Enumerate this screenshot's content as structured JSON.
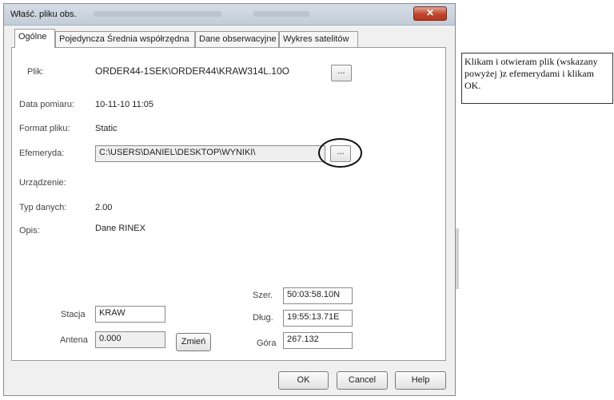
{
  "window": {
    "title": "Właść. pliku obs."
  },
  "tabs": [
    "Ogólne",
    "Pojedyncza Średnia współrzędna",
    "Dane obserwacyjne",
    "Wykres satelitów"
  ],
  "general": {
    "plik_label": "Plik:",
    "plik_value": "ORDER44-1SEK\\ORDER44\\KRAW314L.10O",
    "browse_label": "...",
    "data_label": "Data pomiaru:",
    "data_value": "10-11-10 11:05",
    "format_label": "Format pliku:",
    "format_value": "Static",
    "efemeryda_label": "Efemeryda:",
    "efemeryda_value": "C:\\USERS\\DANIEL\\DESKTOP\\WYNIKI\\",
    "urzadzenie_label": "Urządzenie:",
    "typ_label": "Typ danych:",
    "typ_value": "2.00",
    "opis_label": "Opis:",
    "opis_value": "Dane RINEX"
  },
  "station": {
    "stacja_label": "Stacja",
    "stacja_value": "KRAW",
    "antena_label": "Antena",
    "antena_value": "0.000",
    "zmien_label": "Zmień"
  },
  "coords": {
    "szer_label": "Szer.",
    "szer_value": "50:03:58.10N",
    "dlug_label": "Dług.",
    "dlug_value": "19:55:13.71E",
    "gora_label": "Góra",
    "gora_value": "267.132"
  },
  "footer": {
    "ok": "OK",
    "cancel": "Cancel",
    "help": "Help"
  },
  "annotation": "Klikam i otwieram plik (wskazany powyżej )z efemerydami i klikam OK."
}
